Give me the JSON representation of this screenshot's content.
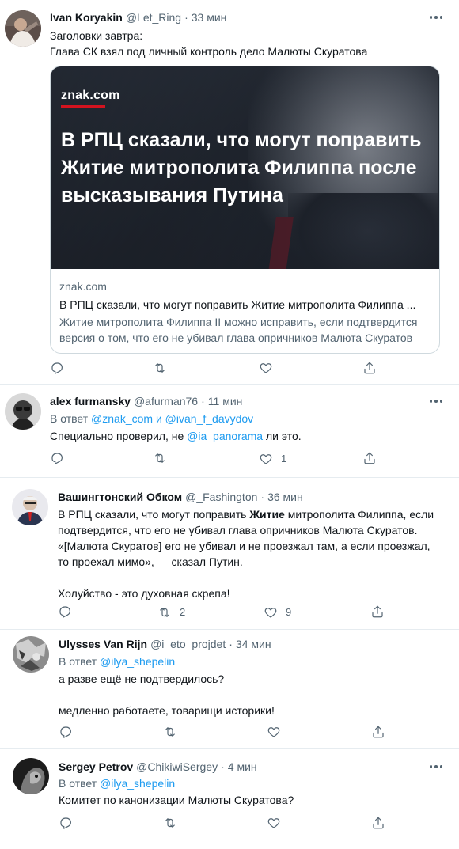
{
  "tweets": [
    {
      "name": "Ivan Koryakin",
      "handle": "@Let_Ring",
      "time": "33 мин",
      "line1": "Заголовки завтра:",
      "line2": "Глава СК взял под личный контроль дело Малюты Скуратова",
      "card": {
        "brand": "znak.com",
        "headline": "В РПЦ сказали, что могут поправить Житие митрополита Филиппа после высказывания Путина",
        "domain": "znak.com",
        "title": "В РПЦ сказали, что могут поправить Житие митрополита Филиппа ...",
        "desc": "Житие митрополита Филиппа II можно исправить, если подтвердится версия о том, что его не убивал глава опричников Малюта Скуратов"
      },
      "replies": "",
      "retweets": "",
      "likes": ""
    },
    {
      "name": "alex furmansky",
      "handle": "@afurman76",
      "time": "11 мин",
      "reply_prefix": "В ответ",
      "reply_user1": "@znak_com",
      "reply_and": "и",
      "reply_user2": "@ivan_f_davydov",
      "text_before": "Специально проверил, не",
      "mention": "@ia_panorama",
      "text_after": "ли это.",
      "likes": "1"
    },
    {
      "name": "Вашингтонский Обком",
      "handle": "@_Fashington",
      "time": "36 мин",
      "p1_before": "В РПЦ сказали, что могут поправить",
      "p1_bold": "Житие",
      "p1_after": "митрополита Филиппа, если подтвердится, что его не убивал глава опричников Малюта Скуратов. «[Малюта Скуратов] его не убивал и не проезжал там, а если проезжал, то проехал мимо», — сказал Путин.",
      "p2": "Холуйство - это духовная скрепа!",
      "retweets": "2",
      "likes": "9"
    },
    {
      "name": "Ulysses Van Rijn",
      "handle": "@i_eto_projdet",
      "time": "34 мин",
      "reply_prefix": "В ответ",
      "reply_user": "@ilya_shepelin",
      "line1": "а разве ещё не подтвердилось?",
      "line2": "медленно работаете, товарищи историки!"
    },
    {
      "name": "Sergey Petrov",
      "handle": "@ChikiwiSergey",
      "time": "4 мин",
      "reply_prefix": "В ответ",
      "reply_user": "@ilya_shepelin",
      "line1": "Комитет по канонизации Малюты Скуратова?"
    }
  ],
  "separator": "·"
}
